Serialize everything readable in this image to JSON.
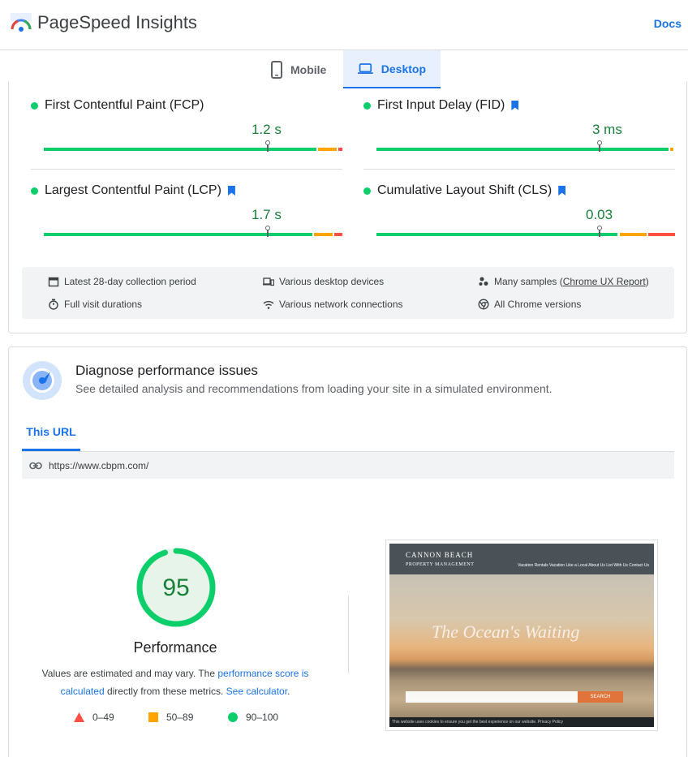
{
  "header": {
    "brand": "PageSpeed Insights",
    "docs_label": "Docs"
  },
  "device_tabs": {
    "mobile_label": "Mobile",
    "desktop_label": "Desktop",
    "active": "Desktop"
  },
  "metrics": [
    {
      "name": "First Contentful Paint (FCP)",
      "value": "1.2 s",
      "bookmark": false,
      "status": "good",
      "marker_fraction": 0.82
    },
    {
      "name": "First Input Delay (FID)",
      "value": "3 ms",
      "bookmark": true,
      "status": "good",
      "marker_fraction": 0.75
    },
    {
      "name": "Largest Contentful Paint (LCP)",
      "value": "1.7 s",
      "bookmark": true,
      "status": "good",
      "marker_fraction": 0.82
    },
    {
      "name": "Cumulative Layout Shift (CLS)",
      "value": "0.03",
      "bookmark": true,
      "status": "good",
      "marker_fraction": 0.75
    }
  ],
  "field_info": {
    "collection_period": "Latest 28-day collection period",
    "visit_durations": "Full visit durations",
    "devices": "Various desktop devices",
    "network": "Various network connections",
    "samples_prefix": "Many samples (",
    "samples_link": "Chrome UX Report",
    "samples_suffix": ")",
    "chrome_versions": "All Chrome versions"
  },
  "diagnose": {
    "title": "Diagnose performance issues",
    "subtitle": "See detailed analysis and recommendations from loading your site in a simulated environment.",
    "tab_label": "This URL",
    "url": "https://www.cbpm.com/"
  },
  "performance": {
    "score": "95",
    "score_fraction": 0.95,
    "label": "Performance",
    "note_1": "Values are estimated and may vary. The ",
    "note_link_1": "performance score is calculated",
    "note_2": " directly from these metrics. ",
    "note_link_2": "See calculator",
    "note_3": ".",
    "legend": [
      {
        "range": "0–49",
        "color": "#ff4e42",
        "shape": "triangle"
      },
      {
        "range": "50–89",
        "color": "#ffa400",
        "shape": "square"
      },
      {
        "range": "90–100",
        "color": "#0cce6b",
        "shape": "circle"
      }
    ]
  },
  "screenshot": {
    "brand_line1": "CANNON BEACH",
    "brand_line2": "PROPERTY MANAGEMENT",
    "script_text": "The Ocean's Waiting",
    "nav_text": "Vacation Rentals   Vacation Like a Local   About Us   List With Us   Contact Us",
    "search_label": "SEARCH",
    "footer_text": "This website uses cookies to ensure you get the best experience on our website.   Privacy Policy"
  },
  "colors": {
    "accent": "#1a73e8",
    "good": "#0cce6b",
    "average": "#ffa400",
    "poor": "#ff4e42",
    "good_text": "#188038"
  }
}
